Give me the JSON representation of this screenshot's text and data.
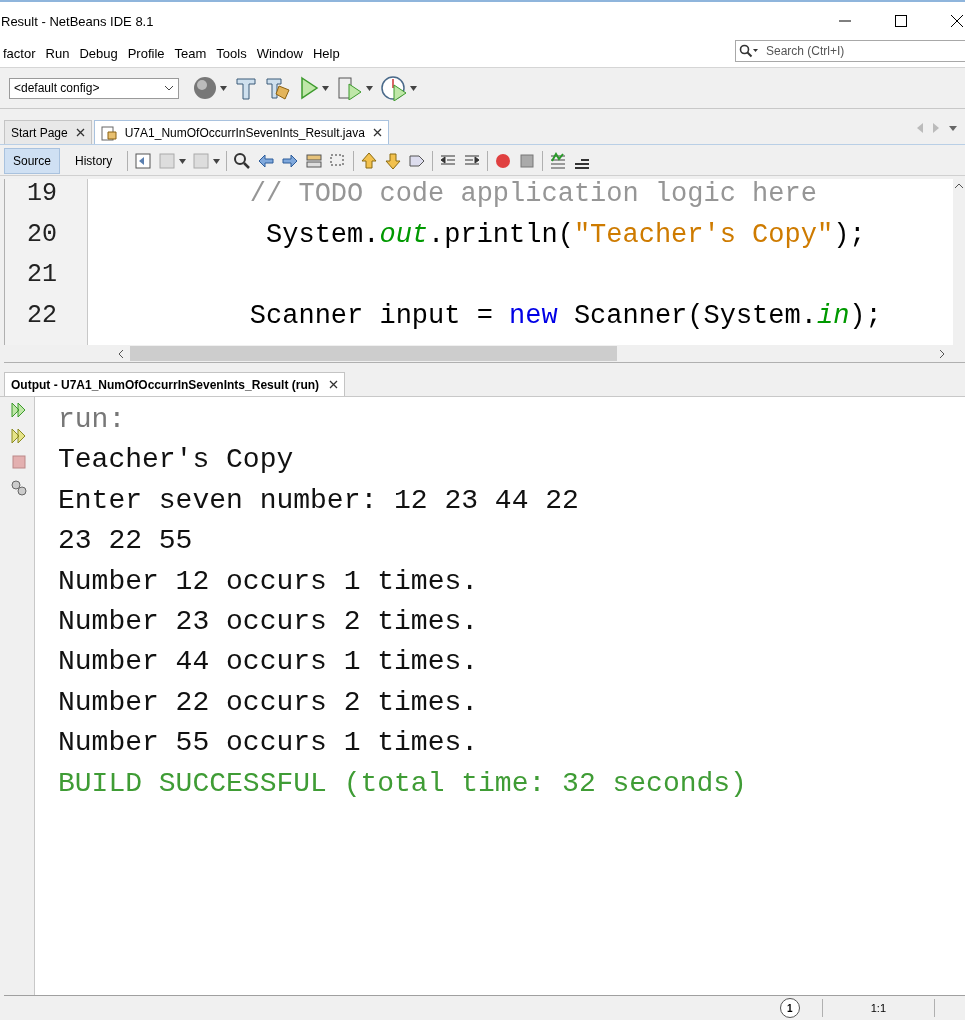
{
  "window": {
    "title": "Result - NetBeans IDE 8.1"
  },
  "menu": [
    {
      "label": "factor"
    },
    {
      "label": "Run"
    },
    {
      "label": "Debug"
    },
    {
      "label": "Profile"
    },
    {
      "label": "Team"
    },
    {
      "label": "Tools"
    },
    {
      "label": "Window"
    },
    {
      "label": "Help"
    }
  ],
  "search": {
    "placeholder": "Search (Ctrl+I)"
  },
  "toolbar": {
    "config": "<default config>"
  },
  "editor_tabs": [
    {
      "label": "Start Page",
      "selected": false
    },
    {
      "label": "U7A1_NumOfOccurrInSevenInts_Result.java",
      "selected": true
    }
  ],
  "view_tabs": [
    {
      "label": "Source",
      "selected": true
    },
    {
      "label": "History",
      "selected": false
    }
  ],
  "code": [
    {
      "number": "19",
      "tokens": [
        {
          "kind": "comment",
          "text": "         // TODO code application logic here"
        }
      ]
    },
    {
      "number": "20",
      "tokens": [
        {
          "kind": "plain",
          "text": "          System."
        },
        {
          "kind": "field",
          "text": "out"
        },
        {
          "kind": "plain",
          "text": ".println("
        },
        {
          "kind": "string",
          "text": "\"Teacher's Copy\""
        },
        {
          "kind": "plain",
          "text": ");"
        }
      ]
    },
    {
      "number": "21"
    },
    {
      "number": "22",
      "tokens": [
        {
          "kind": "plain",
          "text": "         Scanner input = "
        },
        {
          "kind": "keyword",
          "text": "new"
        },
        {
          "kind": "plain",
          "text": " Scanner(System."
        },
        {
          "kind": "field",
          "text": "in"
        },
        {
          "kind": "plain",
          "text": ");"
        }
      ]
    }
  ],
  "output": {
    "title": "Output - U7A1_NumOfOccurrInSevenInts_Result (run)",
    "lines": [
      {
        "kind": "system",
        "text": "run:"
      },
      {
        "kind": "plain",
        "text": "Teacher's Copy"
      },
      {
        "kind": "plain",
        "text": "Enter seven number: 12 23 44 22"
      },
      {
        "kind": "plain",
        "text": "23 22 55"
      },
      {
        "kind": "plain",
        "text": "Number 12 occurs 1 times."
      },
      {
        "kind": "plain",
        "text": "Number 23 occurs 2 times."
      },
      {
        "kind": "plain",
        "text": "Number 44 occurs 1 times."
      },
      {
        "kind": "plain",
        "text": "Number 22 occurs 2 times."
      },
      {
        "kind": "plain",
        "text": "Number 55 occurs 1 times."
      },
      {
        "kind": "success",
        "text": "BUILD SUCCESSFUL (total time: 32 seconds)"
      }
    ]
  },
  "status_bar": {
    "notifications": "1",
    "position": "1:1"
  }
}
